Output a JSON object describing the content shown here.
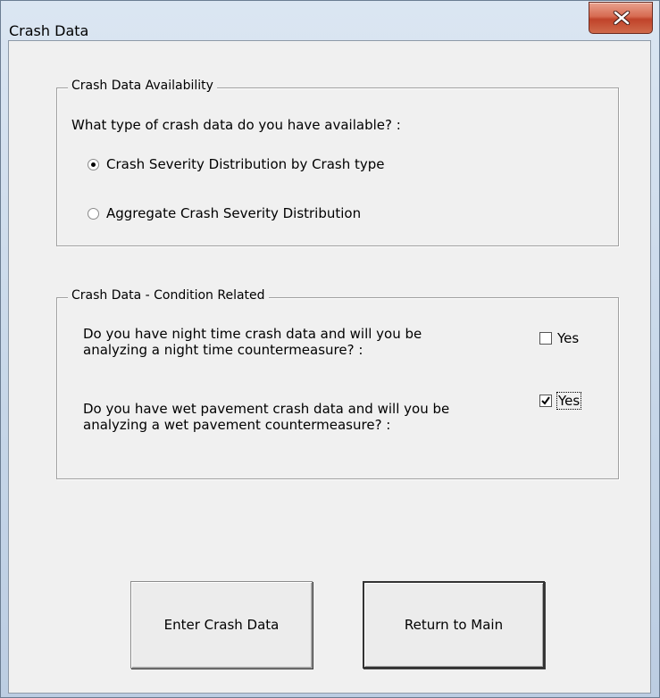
{
  "window": {
    "title": "Crash Data",
    "close_icon": "close-icon"
  },
  "availability": {
    "legend": "Crash Data Availability",
    "question": "What type of crash data do you have available? :",
    "options": [
      {
        "label": "Crash Severity Distribution by Crash type",
        "selected": true
      },
      {
        "label": "Aggregate Crash Severity Distribution",
        "selected": false
      }
    ]
  },
  "conditions": {
    "legend": "Crash Data - Condition Related",
    "night_question_line1": "Do you have night time crash data and will you be",
    "night_question_line2": "analyzing a night time countermeasure? :",
    "night_checkbox_label": "Yes",
    "night_checked": false,
    "wet_question_line1": "Do you have wet pavement crash data and will you be",
    "wet_question_line2": "analyzing a wet pavement countermeasure? :",
    "wet_checkbox_label": "Yes",
    "wet_checked": true
  },
  "buttons": {
    "enter_label": "Enter Crash Data",
    "return_label": "Return to Main"
  }
}
